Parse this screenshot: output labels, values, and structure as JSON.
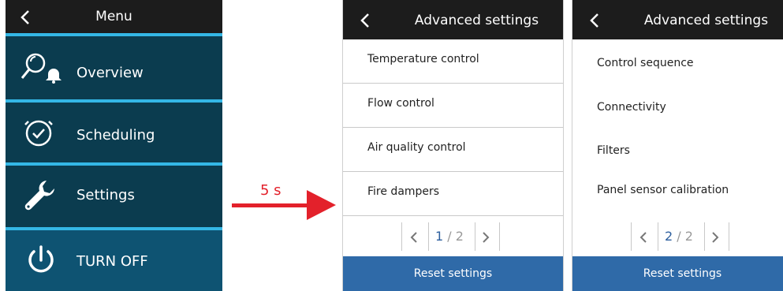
{
  "menu": {
    "title": "Menu",
    "items": [
      {
        "label": "Overview",
        "icon": "overview-search-bell-icon"
      },
      {
        "label": "Scheduling",
        "icon": "clock-check-icon"
      },
      {
        "label": "Settings",
        "icon": "wrench-icon"
      },
      {
        "label": "TURN OFF",
        "icon": "power-icon"
      }
    ]
  },
  "transition": {
    "label": "5 s"
  },
  "panel1": {
    "title": "Advanced settings",
    "rows": [
      "Temperature control",
      "Flow control",
      "Air quality control",
      "Fire dampers"
    ],
    "page_current": "1",
    "page_sep": "/",
    "page_total": "2",
    "reset_label": "Reset settings"
  },
  "panel2": {
    "title": "Advanced settings",
    "rows": [
      "Control sequence",
      "Connectivity",
      "Filters",
      "Panel sensor calibration"
    ],
    "page_current": "2",
    "page_sep": "/",
    "page_total": "2",
    "reset_label": "Reset settings"
  },
  "colors": {
    "menu_bg": "#0b3c4f",
    "separator": "#34b7e6",
    "reset_bg": "#2f6aa8",
    "arrow": "#e3212b"
  }
}
